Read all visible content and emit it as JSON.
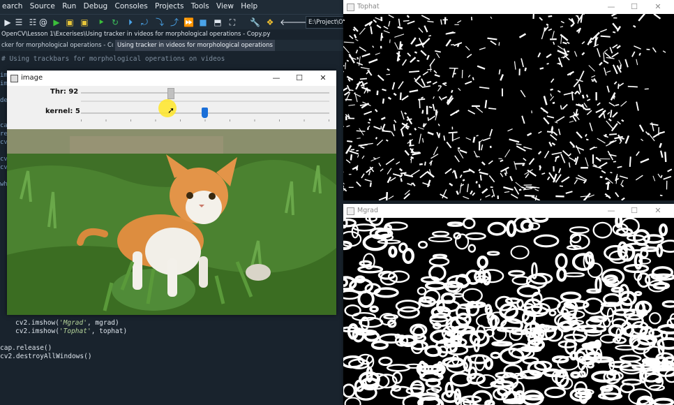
{
  "ide": {
    "menu": [
      "earch",
      "Source",
      "Run",
      "Debug",
      "Consoles",
      "Projects",
      "Tools",
      "View",
      "Help"
    ],
    "path_box": "E:\\Project\\On",
    "file_path": "OpenCV\\Lesson 1\\Excerises\\Using tracker in videos for morphological operations - Copy.py",
    "tabs": [
      {
        "label": "cker for morphological operations - Copy.py",
        "active": false
      },
      {
        "label": "Using tracker in videos for morphological operations - Copy.py",
        "active": true
      }
    ],
    "code": {
      "comment": "# Using trackbars for morphological operations on videos",
      "line_imshow_mgrad_pre": "cv2.imshow(",
      "line_imshow_mgrad_str": "'Mgrad'",
      "line_imshow_mgrad_post": ", mgrad)",
      "line_imshow_tophat_pre": "cv2.imshow(",
      "line_imshow_tophat_str": "'Tophat'",
      "line_imshow_tophat_post": ", tophat)",
      "line_release": "cap.release()",
      "line_destroy": "cv2.destroyAllWindows()"
    },
    "gutter": [
      "im",
      "im",
      "de",
      "ca",
      "re",
      "cv",
      "cv",
      "cv",
      "wh"
    ]
  },
  "image_window": {
    "title": "image",
    "thr_label": "Thr: 92",
    "thr_value": 92,
    "kernel_label": "kernel: 5",
    "kernel_value": 5
  },
  "tophat_window": {
    "title": "Tophat"
  },
  "mgrad_window": {
    "title": "Mgrad"
  },
  "window_controls": {
    "minimize": "—",
    "maximize": "☐",
    "close": "✕"
  },
  "colors": {
    "accent": "#1a6fd8",
    "ide_bg": "#19232d"
  }
}
